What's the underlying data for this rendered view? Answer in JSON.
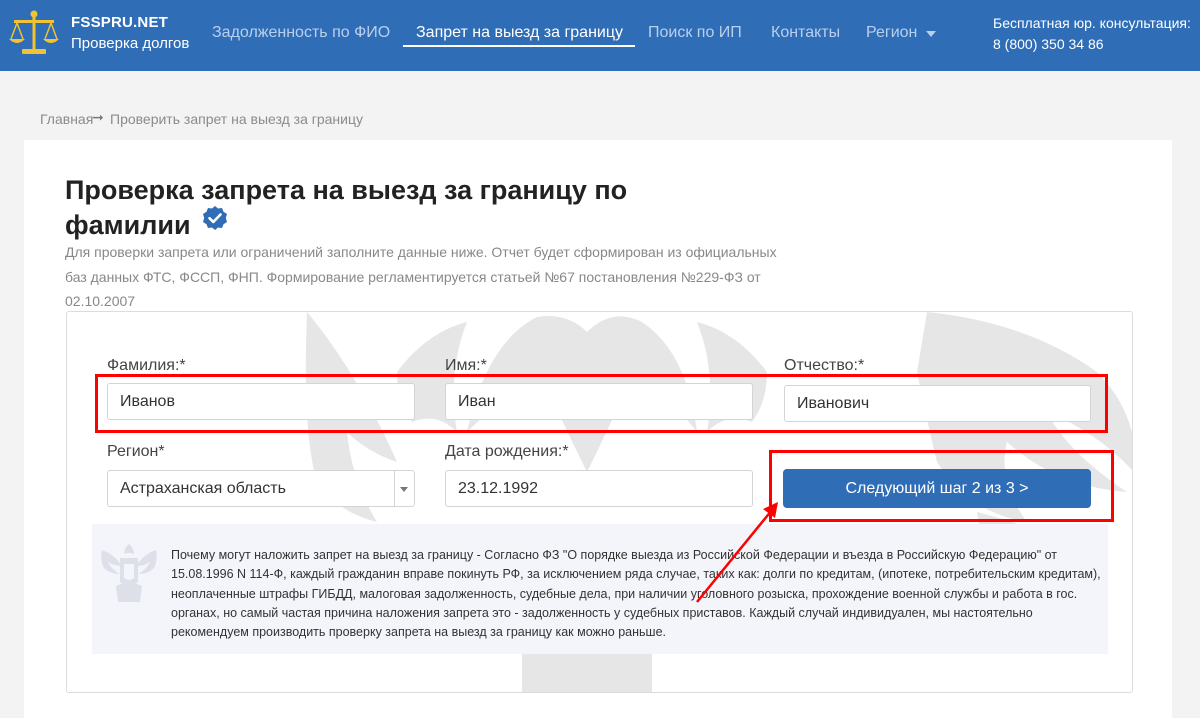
{
  "header": {
    "logo_title": "FSSPRU.NET",
    "logo_subtitle": "Проверка долгов",
    "nav": [
      {
        "label": "Задолженность по ФИО"
      },
      {
        "label": "Запрет на выезд за границу"
      },
      {
        "label": "Поиск по ИП"
      },
      {
        "label": "Контакты"
      },
      {
        "label": "Регион"
      }
    ],
    "consult_label": "Бесплатная юр. консультация:",
    "phone": "8 (800) 350 34 86",
    "brand_color": "#2f6db7",
    "logo_icon": "scales-icon"
  },
  "breadcrumb": {
    "home": "Главная",
    "arrow": "➞",
    "current": "Проверить запрет на выезд за границу"
  },
  "page": {
    "title": "Проверка запрета на выезд за границу по фамилии",
    "verified_icon": "verified-check-icon",
    "intro": "Для проверки запрета или ограничений заполните данные ниже. Отчет будет сформирован из официальных баз данных ФТС, ФССП, ФНП. Формирование регламентируется статьей №67 постановления №229-ФЗ от 02.10.2007"
  },
  "form": {
    "surname_label": "Фамилия:*",
    "surname_value": "Иванов",
    "name_label": "Имя:*",
    "name_value": "Иван",
    "patronymic_label": "Отчество:*",
    "patronymic_value": "Иванович",
    "region_label": "Регион*",
    "region_value": "Астраханская область",
    "birthdate_label": "Дата рождения:*",
    "birthdate_value": "23.12.1992",
    "next_button": "Следующий шаг 2 из 3 >"
  },
  "info": {
    "emblem_icon": "eagle-emblem-icon",
    "text": "Почему могут наложить запрет на выезд за границу - Согласно ФЗ \"О порядке выезда из Российской Федерации и въезда в Российскую Федерацию\" от 15.08.1996 N 114-Ф, каждый гражданин вправе покинуть РФ, за исключением ряда случае, таких как: долги по кредитам, (ипотеке, потребительским кредитам), неоплаченные штрафы ГИБДД, малоговая задолженность, судебные дела, при наличии уголовного розыска, прохождение военной службы и работа в гос. органах, но самый частая причина наложения запрета это - задолженность у судебных приставов. Каждый случай индивидуален, мы настоятельно рекомендуем производить проверку запрета на выезд за границу как можно раньше."
  },
  "annotations": {
    "highlight_color": "#ff0000"
  }
}
